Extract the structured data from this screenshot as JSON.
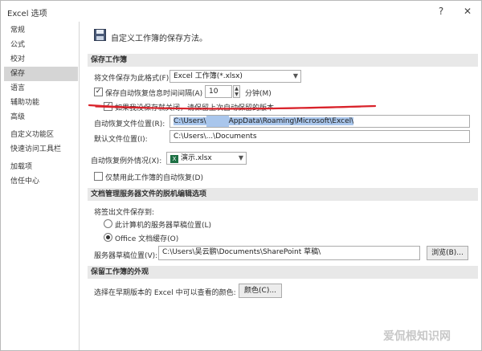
{
  "window": {
    "title": "Excel 选项",
    "help": "?",
    "close": "✕"
  },
  "sidebar": {
    "items": [
      {
        "label": "常规"
      },
      {
        "label": "公式"
      },
      {
        "label": "校对"
      },
      {
        "label": "保存"
      },
      {
        "label": "语言"
      },
      {
        "label": "辅助功能"
      },
      {
        "label": "高级"
      },
      {
        "label": "自定义功能区"
      },
      {
        "label": "快速访问工具栏"
      },
      {
        "label": "加载项"
      },
      {
        "label": "信任中心"
      }
    ],
    "active_index": 3
  },
  "main": {
    "header": "自定义工作簿的保存方法。",
    "save_section": {
      "title": "保存工作簿",
      "format_label": "将文件保存为此格式(F):",
      "format_value": "Excel 工作簿(*.xlsx)",
      "autorecover_label": "保存自动恢复信息时间间隔(A)",
      "autorecover_minutes": "10",
      "minutes_label": "分钟(M)",
      "keep_last_label": "如果我没保存就关闭，请保留上次自动保留的版本",
      "autorecover_location_label": "自动恢复文件位置(R):",
      "autorecover_location_value_prefix": "C:\\Users\\",
      "autorecover_location_value_suffix": "AppData\\Roaming\\Microsoft\\Excel\\",
      "default_location_label": "默认文件位置(I):",
      "default_location_value": "C:\\Users\\...\\Documents"
    },
    "exceptions_section": {
      "label": "自动恢复例外情况(X):",
      "workbook": "演示.xlsx",
      "disable_label": "仅禁用此工作簿的自动恢复(D)"
    },
    "offline_section": {
      "title": "文档管理服务器文件的脱机编辑选项",
      "save_to_label": "将签出文件保存到:",
      "option_server": "此计算机的服务器草稿位置(L)",
      "option_office_cache": "Office 文档缓存(O)",
      "drafts_label": "服务器草稿位置(V):",
      "drafts_value": "C:\\Users\\吴云鹏\\Documents\\SharePoint 草稿\\",
      "browse_label": "浏览(B)..."
    },
    "appearance_section": {
      "title": "保留工作簿的外观",
      "colors_label": "选择在早期版本的 Excel 中可以查看的颜色:",
      "colors_button": "颜色(C)..."
    }
  },
  "watermark": "爱侃根知识网",
  "colors": {
    "selection": "#a9c6ec",
    "annotation": "#d9232b",
    "excel_green": "#1d7044"
  }
}
